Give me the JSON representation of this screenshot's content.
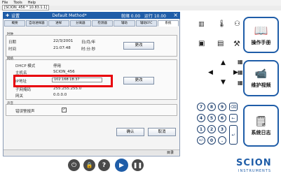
{
  "menu": [
    "File",
    "Tools",
    "Help"
  ],
  "address": "[SCION_456 * 10.83.1.1]",
  "titlebar": {
    "home_label": "设置",
    "method": "Default Method*",
    "status": "就绪 0.00",
    "status2": "运行 10.00"
  },
  "tabs": [
    "概要",
    "自动进样器",
    "进样",
    "分离器",
    "检测器",
    "辅助",
    "辅助EFC",
    "系统"
  ],
  "active_tab": 7,
  "time_panel": {
    "legend": "时钟",
    "date_label": "日期",
    "date_value": "22/3/2001",
    "date_format": "日/月/年",
    "time_label": "时间",
    "time_value": "21:07:48",
    "time_format": "时:分:秒",
    "change_button": "更改"
  },
  "network_panel": {
    "legend": "网络",
    "dhcp_label": "DHCP 模式",
    "dhcp_value": "停用",
    "host_label": "主机名",
    "host_value": "SCION_456",
    "ip_label": "IP地址",
    "ip_value": "102.168.18.37",
    "mask_label": "子网掩码",
    "mask_value": "255.255.255.0",
    "gateway_label": "网关",
    "gateway_value": "0.0.0.0",
    "change_button": "更改"
  },
  "sound_panel": {
    "legend": "声音",
    "label": "错误警报声",
    "checkbox_mark": "✓"
  },
  "ok_button": "确认",
  "cancel_button": "取消",
  "bottom_status": "目录",
  "keypad": {
    "keys": [
      "7",
      "8",
      "9",
      "4",
      "5",
      "6",
      "1",
      "2",
      "3",
      "+/-",
      "0",
      "."
    ]
  },
  "side_buttons": {
    "manual": "操作手册",
    "video": "维护视频",
    "log": "系统日志"
  },
  "brand": {
    "name": "SCION",
    "sub": "INSTRUMENTS",
    "color": "#1f5da8"
  }
}
